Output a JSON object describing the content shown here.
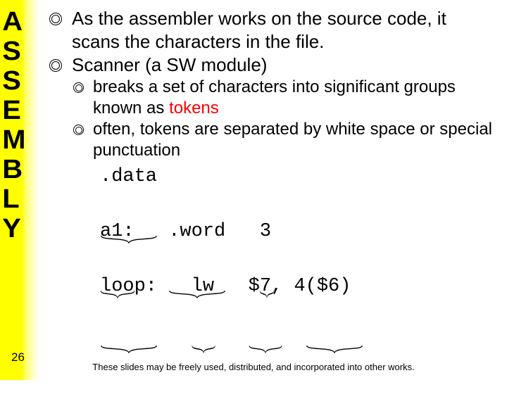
{
  "sidebar": {
    "title_vertical": "ASSEMBLY"
  },
  "slide_number": "26",
  "footer": "These slides may be freely used, distributed, and incorporated into other works.",
  "bullets": {
    "b1": "As the assembler works on the source code, it scans the characters in the file.",
    "b2": "Scanner (a SW module)",
    "sub1_a": "breaks a set of characters into significant groups known as ",
    "sub1_tok": "tokens",
    "sub2": "often, tokens are separated  by white space or special punctuation"
  },
  "code": {
    "line1": {
      "seg1": ".data"
    },
    "line2": {
      "seg1": "a1:",
      "seg2": ".word",
      "seg3": "3"
    },
    "line3": {
      "seg1": "loop:",
      "seg2": "lw",
      "seg3": "$7,",
      "seg4": "4($6)"
    }
  }
}
